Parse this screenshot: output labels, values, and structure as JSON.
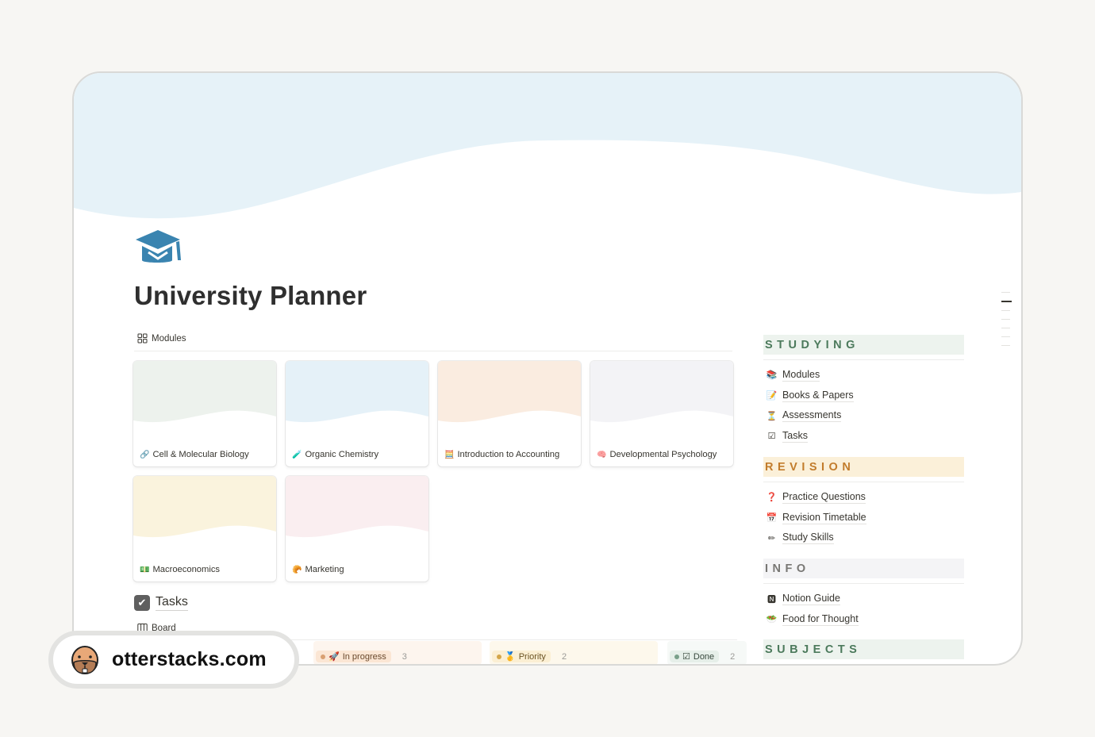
{
  "page": {
    "title": "University Planner",
    "icon": "graduation-cap-icon",
    "cover_color": "#e6f2f8"
  },
  "modules_view": {
    "label": "Modules",
    "icon": "gallery-icon",
    "cards": [
      {
        "title": "Cell & Molecular Biology",
        "emoji": "🔗",
        "cover_color": "#edf2ed"
      },
      {
        "title": "Organic Chemistry",
        "emoji": "🧪",
        "cover_color": "#e5f1f8"
      },
      {
        "title": "Introduction to Accounting",
        "emoji": "🧮",
        "cover_color": "#faece0"
      },
      {
        "title": "Developmental Psychology",
        "emoji": "🧠",
        "cover_color": "#f3f3f6"
      },
      {
        "title": "Macroeconomics",
        "emoji": "💵",
        "cover_color": "#faf3dd"
      },
      {
        "title": "Marketing",
        "emoji": "🥐",
        "cover_color": "#faeef0"
      }
    ]
  },
  "tasks": {
    "heading": "Tasks",
    "icon": "tasks-checkbox-icon",
    "view_label": "Board",
    "view_icon": "board-icon",
    "columns": [
      {
        "label": "In progress",
        "emoji": "🚀",
        "count": "3",
        "pill_bg": "#fbe6d4",
        "dot": "#d9a072",
        "text": "#6b4a2e",
        "col_bg": "#fdf5ee"
      },
      {
        "label": "Priority",
        "emoji": "🥇",
        "count": "2",
        "pill_bg": "#fbefd3",
        "dot": "#d4a64a",
        "text": "#6b5324",
        "col_bg": "#fdf8ec"
      },
      {
        "label": "Done",
        "emoji": "☑",
        "count": "2",
        "pill_bg": "#e6efe9",
        "dot": "#7aa08a",
        "text": "#37483d",
        "col_bg": "#f6f9f7"
      }
    ]
  },
  "sidebar": {
    "sections": [
      {
        "title": "STUDYING",
        "color": "#4c7a5c",
        "bg": "#edf3ee",
        "items": [
          {
            "label": "Modules",
            "emoji": "📚"
          },
          {
            "label": "Books & Papers",
            "emoji": "📝"
          },
          {
            "label": "Assessments",
            "emoji": "⏳"
          },
          {
            "label": "Tasks",
            "emoji": "☑"
          }
        ]
      },
      {
        "title": "REVISION",
        "color": "#c27c2c",
        "bg": "#fbf0d9",
        "items": [
          {
            "label": "Practice Questions",
            "emoji": "❓"
          },
          {
            "label": "Revision Timetable",
            "emoji": "📅"
          },
          {
            "label": "Study Skills",
            "emoji": "✏"
          }
        ]
      },
      {
        "title": "INFO",
        "color": "#787774",
        "bg": "#f4f4f6",
        "items": [
          {
            "label": "Notion Guide",
            "emoji": "🅽"
          },
          {
            "label": "Food for Thought",
            "emoji": "🥗"
          }
        ]
      },
      {
        "title": "SUBJECTS",
        "color": "#4c7a5c",
        "bg": "#edf3ee",
        "items": []
      }
    ]
  },
  "watermark": {
    "text": "otterstacks.com",
    "icon": "otter-face-icon"
  }
}
